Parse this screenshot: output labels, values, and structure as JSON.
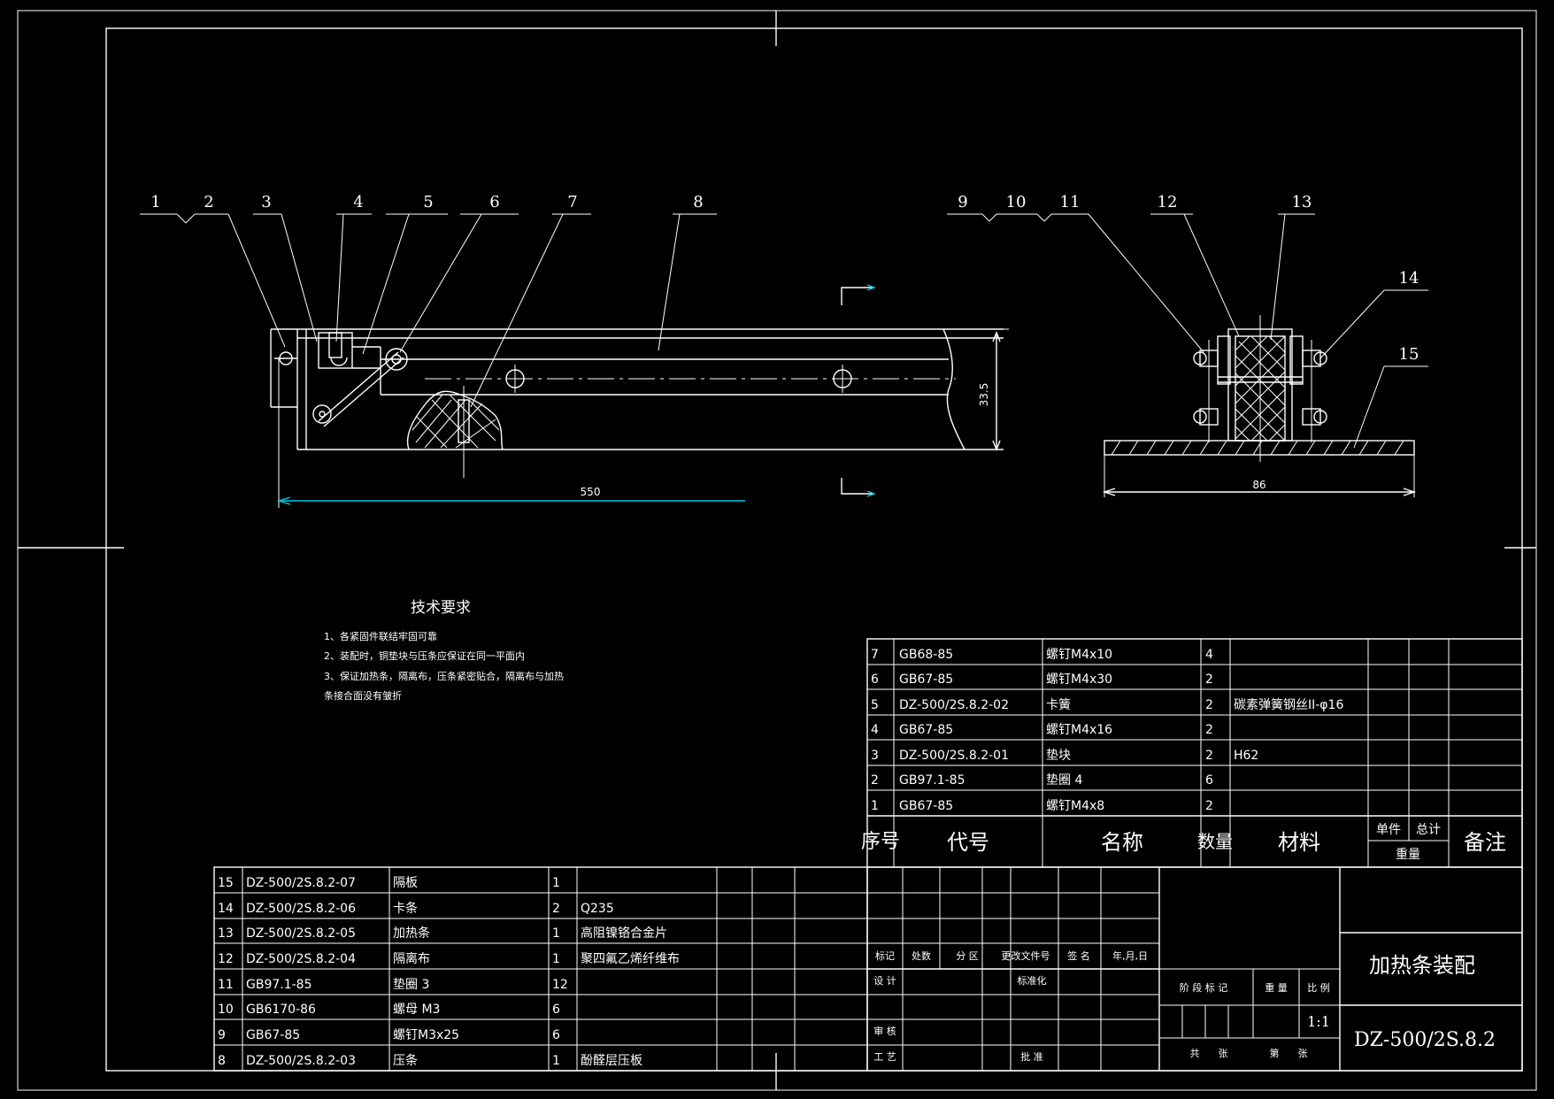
{
  "tech_requirements": {
    "title": "技术要求",
    "items": [
      "1、各紧固件联结牢固可靠",
      "2、装配时，铜垫块与压条应保证在同一平面内",
      "3、保证加热条，隔离布，压条紧密贴合，隔离布与加热",
      "条接合面没有皱折"
    ]
  },
  "balloons_front": [
    "1",
    "2",
    "3",
    "4",
    "5",
    "6",
    "7",
    "8"
  ],
  "balloons_side": [
    "9",
    "10",
    "11",
    "12",
    "13",
    "14",
    "15"
  ],
  "dimensions": {
    "length": "550",
    "height": "33.5",
    "width": "86"
  },
  "bom_upper": [
    {
      "no": "7",
      "code": "GB68-85",
      "name": "螺钉M4x10",
      "qty": "4",
      "material": ""
    },
    {
      "no": "6",
      "code": "GB67-85",
      "name": "螺钉M4x30",
      "qty": "2",
      "material": ""
    },
    {
      "no": "5",
      "code": "DZ-500/2S.8.2-02",
      "name": "卡簧",
      "qty": "2",
      "material": "碳素弹簧钢丝II-φ16"
    },
    {
      "no": "4",
      "code": "GB67-85",
      "name": "螺钉M4x16",
      "qty": "2",
      "material": ""
    },
    {
      "no": "3",
      "code": "DZ-500/2S.8.2-01",
      "name": "垫块",
      "qty": "2",
      "material": "H62"
    },
    {
      "no": "2",
      "code": "GB97.1-85",
      "name": "垫圈 4",
      "qty": "6",
      "material": ""
    },
    {
      "no": "1",
      "code": "GB67-85",
      "name": "螺钉M4x8",
      "qty": "2",
      "material": ""
    }
  ],
  "bom_header": {
    "no": "序号",
    "code": "代号",
    "name": "名称",
    "qty": "数量",
    "material": "材料",
    "unit_weight": "单件",
    "total_weight": "总计",
    "weight": "重量",
    "remark": "备注"
  },
  "bom_lower": [
    {
      "no": "15",
      "code": "DZ-500/2S.8.2-07",
      "name": "隔板",
      "qty": "1",
      "material": ""
    },
    {
      "no": "14",
      "code": "DZ-500/2S.8.2-06",
      "name": "卡条",
      "qty": "2",
      "material": "Q235"
    },
    {
      "no": "13",
      "code": "DZ-500/2S.8.2-05",
      "name": "加热条",
      "qty": "1",
      "material": "高阻镍铬合金片"
    },
    {
      "no": "12",
      "code": "DZ-500/2S.8.2-04",
      "name": "隔离布",
      "qty": "1",
      "material": "聚四氟乙烯纤维布"
    },
    {
      "no": "11",
      "code": "GB97.1-85",
      "name": "垫圈 3",
      "qty": "12",
      "material": ""
    },
    {
      "no": "10",
      "code": "GB6170-86",
      "name": "螺母 M3",
      "qty": "6",
      "material": ""
    },
    {
      "no": "9",
      "code": "GB67-85",
      "name": "螺钉M3x25",
      "qty": "6",
      "material": ""
    },
    {
      "no": "8",
      "code": "DZ-500/2S.8.2-03",
      "name": "压条",
      "qty": "1",
      "material": "酚醛层压板"
    }
  ],
  "title_block": {
    "mark": "标记",
    "count": "处数",
    "zone": "分 区",
    "change_doc": "更改文件号",
    "sign": "签 名",
    "date": "年,月,日",
    "design": "设 计",
    "standardize": "标准化",
    "review": "审 核",
    "process": "工 艺",
    "approve": "批 准",
    "stage_mark": "阶 段 标 记",
    "weight": "重 量",
    "scale_label": "比 例",
    "scale": "1:1",
    "total_sheets": "共      张",
    "sheet_no": "第      张",
    "drawing_title": "加热条装配",
    "drawing_no": "DZ-500/2S.8.2"
  }
}
